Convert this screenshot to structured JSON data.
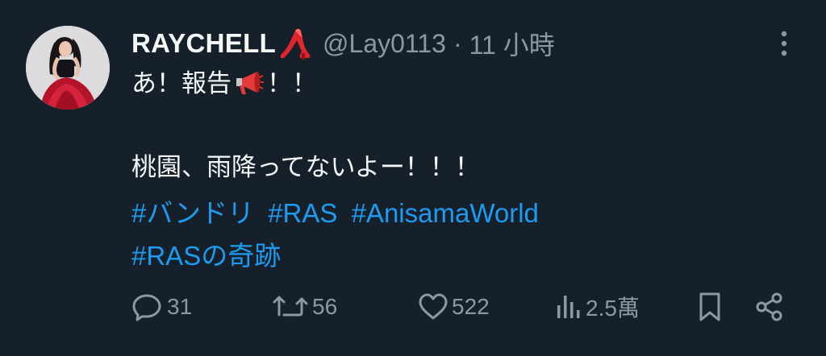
{
  "tweet": {
    "display_name": "RAYCHELL",
    "name_emoji": "high-heel-icon",
    "handle": "@Lay0113",
    "separator": "·",
    "time": "11 小時",
    "line1_before": "あ！報告",
    "line1_emoji": "megaphone-icon",
    "line1_after": "！！",
    "line2": "桃園、雨降ってないよー！！！",
    "hashtags": [
      "#バンドリ",
      "#RAS",
      "#AnisamaWorld",
      "#RASの奇跡"
    ]
  },
  "actions": {
    "replies": "31",
    "retweets": "56",
    "likes": "522",
    "views": "2.5萬"
  },
  "colors": {
    "background": "#15202b",
    "text": "#f7f9f9",
    "secondary": "#8b98a5",
    "accent": "#1d9bf0"
  }
}
